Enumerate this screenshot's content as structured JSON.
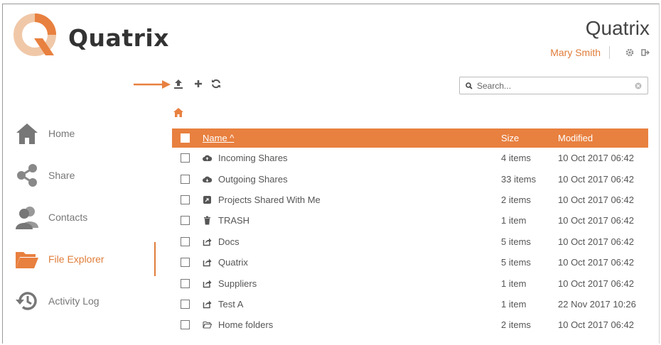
{
  "header": {
    "logo_text": "Quatrix",
    "app_title": "Quatrix",
    "user_name": "Mary Smith"
  },
  "search": {
    "placeholder": "Search..."
  },
  "sidebar": {
    "items": [
      {
        "label": "Home",
        "icon": "home-icon"
      },
      {
        "label": "Share",
        "icon": "share-icon"
      },
      {
        "label": "Contacts",
        "icon": "contacts-icon"
      },
      {
        "label": "File Explorer",
        "icon": "folder-icon",
        "active": true
      },
      {
        "label": "Activity Log",
        "icon": "history-icon"
      }
    ]
  },
  "table": {
    "columns": {
      "name": "Name ^",
      "size": "Size",
      "modified": "Modified"
    },
    "rows": [
      {
        "name": "Incoming Shares",
        "size": "4 items",
        "modified": "10 Oct 2017 06:42",
        "icon": "cloud-icon"
      },
      {
        "name": "Outgoing Shares",
        "size": "33 items",
        "modified": "10 Oct 2017 06:42",
        "icon": "cloud-icon"
      },
      {
        "name": "Projects Shared With Me",
        "size": "2 items",
        "modified": "10 Oct 2017 06:42",
        "icon": "project-share-icon"
      },
      {
        "name": "TRASH",
        "size": "1 item",
        "modified": "10 Oct 2017 06:42",
        "icon": "trash-icon"
      },
      {
        "name": "Docs",
        "size": "5 items",
        "modified": "10 Oct 2017 06:42",
        "icon": "share-folder-icon"
      },
      {
        "name": "Quatrix",
        "size": "5 items",
        "modified": "10 Oct 2017 06:42",
        "icon": "share-folder-icon"
      },
      {
        "name": "Suppliers",
        "size": "1 item",
        "modified": "10 Oct 2017 06:42",
        "icon": "share-folder-icon"
      },
      {
        "name": "Test A",
        "size": "1 item",
        "modified": "22 Nov 2017 10:26",
        "icon": "share-folder-icon"
      },
      {
        "name": "Home folders",
        "size": "2 items",
        "modified": "10 Oct 2017 06:42",
        "icon": "folder-open-icon"
      }
    ]
  },
  "colors": {
    "accent": "#e8803f",
    "text": "#555555"
  }
}
